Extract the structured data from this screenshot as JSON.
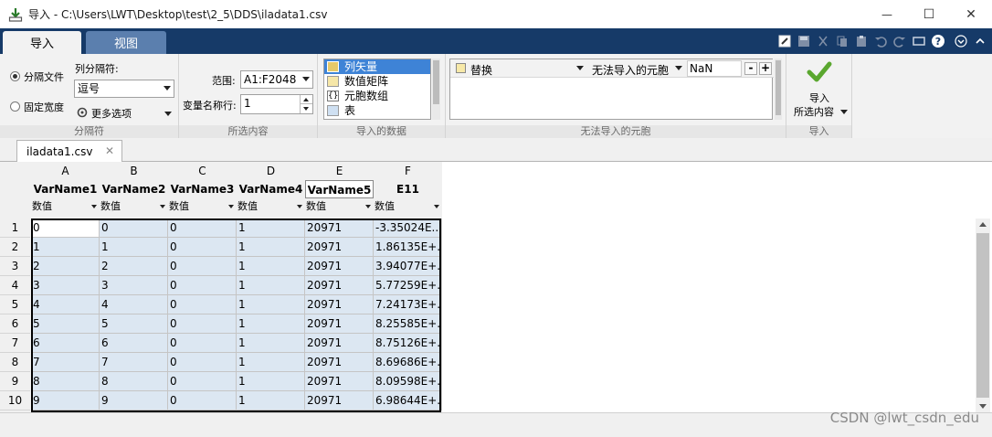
{
  "window": {
    "title": "导入 - C:\\Users\\LWT\\Desktop\\test\\2_5\\DDS\\iladata1.csv",
    "minimize": "—",
    "maximize": "☐",
    "close": "✕"
  },
  "ribbon_tabs": {
    "import": "导入",
    "view": "视图"
  },
  "delimiter_section": {
    "delimited": "分隔文件",
    "fixed_width": "固定宽度",
    "column_delimiter_label": "列分隔符:",
    "column_delimiter_value": "逗号",
    "more_options": "更多选项",
    "section_label": "分隔符"
  },
  "selection_section": {
    "range_label": "范围:",
    "range_value": "A1:F2048",
    "varname_row_label": "变量名称行:",
    "varname_row_value": "1",
    "section_label": "所选内容"
  },
  "import_data_section": {
    "options": [
      "列矢量",
      "数值矩阵",
      "元胞数组",
      "表"
    ],
    "selected": "列矢量",
    "section_label": "导入的数据"
  },
  "unimportable_section": {
    "rule_action": "替换",
    "rule_condition": "无法导入的元胞",
    "rule_value": "NaN",
    "section_label": "无法导入的元胞"
  },
  "import_section": {
    "button_line1": "导入",
    "button_line2": "所选内容",
    "section_label": "导入"
  },
  "document_tab": {
    "filename": "iladata1.csv",
    "close": "✕"
  },
  "table": {
    "column_letters": [
      "A",
      "B",
      "C",
      "D",
      "E",
      "F"
    ],
    "var_names": [
      "VarName1",
      "VarName2",
      "VarName3",
      "VarName4",
      "VarName5",
      "E11"
    ],
    "var_types": [
      "数值",
      "数值",
      "数值",
      "数值",
      "数值",
      "数值"
    ],
    "row_numbers": [
      "1",
      "2",
      "3",
      "4",
      "5",
      "6",
      "7",
      "8",
      "9",
      "10"
    ],
    "rows": [
      [
        "0",
        "0",
        "0",
        "1",
        "20971",
        "-3.35024E..."
      ],
      [
        "1",
        "1",
        "0",
        "1",
        "20971",
        "1.86135E+..."
      ],
      [
        "2",
        "2",
        "0",
        "1",
        "20971",
        "3.94077E+..."
      ],
      [
        "3",
        "3",
        "0",
        "1",
        "20971",
        "5.77259E+..."
      ],
      [
        "4",
        "4",
        "0",
        "1",
        "20971",
        "7.24173E+..."
      ],
      [
        "5",
        "5",
        "0",
        "1",
        "20971",
        "8.25585E+..."
      ],
      [
        "6",
        "6",
        "0",
        "1",
        "20971",
        "8.75126E+..."
      ],
      [
        "7",
        "7",
        "0",
        "1",
        "20971",
        "8.69686E+..."
      ],
      [
        "8",
        "8",
        "0",
        "1",
        "20971",
        "8.09598E+..."
      ],
      [
        "9",
        "9",
        "0",
        "1",
        "20971",
        "6.98644E+..."
      ]
    ]
  },
  "watermark": "CSDN @lwt_csdn_edu",
  "colors": {
    "ribbon_dark": "#163a68",
    "cell_fill": "#dce7f2",
    "selection_blue": "#3e83d6"
  }
}
